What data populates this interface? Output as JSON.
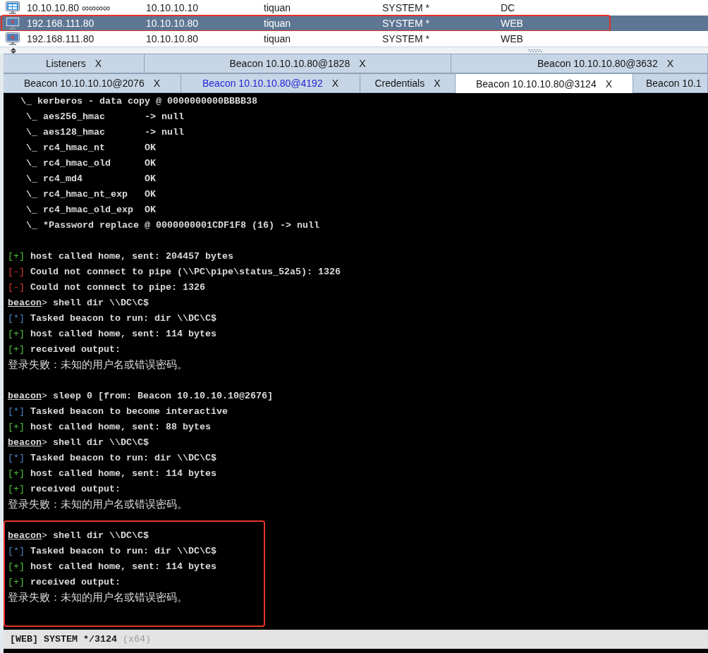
{
  "sessions": {
    "rows": [
      {
        "kind": "monitor",
        "cells": [
          "10.10.10.80 ∞∞∞∞",
          "10.10.10.10",
          "tiquan",
          "SYSTEM *",
          "DC"
        ],
        "selected": false,
        "highlighted": false
      },
      {
        "kind": "bolt",
        "cells": [
          "192.168.111.80",
          "10.10.10.80",
          "tiquan",
          "SYSTEM *",
          "WEB"
        ],
        "selected": true,
        "highlighted": true
      },
      {
        "kind": "bolt",
        "cells": [
          "192.168.111.80",
          "10.10.10.80",
          "tiquan",
          "SYSTEM *",
          "WEB"
        ],
        "selected": false,
        "highlighted": false
      }
    ]
  },
  "tabs": {
    "rows": [
      [
        {
          "label": "Listeners",
          "close": "X",
          "selected": false,
          "highlighted": false
        },
        {
          "label": "Beacon 10.10.10.80@1828",
          "close": "X",
          "selected": false,
          "highlighted": false
        },
        {
          "label": "Beacon 10.10.10.80@3632",
          "close": "X",
          "selected": false,
          "highlighted": false
        }
      ],
      [
        {
          "label": "Beacon 10.10.10.10@2076",
          "close": "X",
          "selected": false,
          "highlighted": false
        },
        {
          "label": "Beacon 10.10.10.80@4192",
          "close": "X",
          "selected": false,
          "highlighted": true
        },
        {
          "label": "Credentials",
          "close": "X",
          "selected": false,
          "highlighted": false
        },
        {
          "label": "Beacon 10.10.10.80@3124",
          "close": "X",
          "selected": true,
          "highlighted": false
        },
        {
          "label": "Beacon 10.1",
          "selected": false,
          "highlighted": false
        }
      ]
    ]
  },
  "console": {
    "blocks": [
      {
        "highlighted": false,
        "lines": [
          {
            "kind": "tree",
            "text": "\\_ kerberos - data copy @ 0000000000BBBB38",
            "children": [
              {
                "kind": "tree",
                "text": "\\_ aes256_hmac       -> null"
              },
              {
                "kind": "tree",
                "text": "\\_ aes128_hmac       -> null"
              },
              {
                "kind": "tree",
                "text": "\\_ rc4_hmac_nt       OK"
              },
              {
                "kind": "tree",
                "text": "\\_ rc4_hmac_old      OK"
              },
              {
                "kind": "tree",
                "text": "\\_ rc4_md4           OK"
              },
              {
                "kind": "tree",
                "text": "\\_ rc4_hmac_nt_exp   OK"
              },
              {
                "kind": "tree",
                "text": "\\_ rc4_hmac_old_exp  OK"
              },
              {
                "kind": "tree",
                "text": "\\_ *Password replace @ 0000000001CDF1F8 (16) -> null"
              }
            ]
          }
        ]
      },
      {
        "highlighted": false,
        "lines": [
          {
            "kind": "success",
            "marker": "[+]",
            "text": "host called home, sent: 204457 bytes"
          },
          {
            "kind": "error",
            "marker": "[-]",
            "text": "Could not connect to pipe (\\\\PC\\pipe\\status_52a5): 1326"
          },
          {
            "kind": "error",
            "marker": "[-]",
            "text": "Could not connect to pipe: 1326"
          },
          {
            "kind": "prompt",
            "prompt": "beacon",
            "sep": ">",
            "text": "shell dir \\\\DC\\C$"
          },
          {
            "kind": "info",
            "marker": "[*]",
            "text": "Tasked beacon to run: dir \\\\DC\\C$"
          },
          {
            "kind": "success",
            "marker": "[+]",
            "text": "host called home, sent: 114 bytes"
          },
          {
            "kind": "success",
            "marker": "[+]",
            "text": "received output:"
          },
          {
            "kind": "output",
            "text": "登录失败：未知的用户名或错误密码。"
          }
        ]
      },
      {
        "highlighted": false,
        "lines": [
          {
            "kind": "prompt",
            "prompt": "beacon",
            "sep": ">",
            "text": "sleep 0 [from: Beacon 10.10.10.10@2676]"
          },
          {
            "kind": "info",
            "marker": "[*]",
            "text": "Tasked beacon to become interactive"
          },
          {
            "kind": "success",
            "marker": "[+]",
            "text": "host called home, sent: 88 bytes"
          },
          {
            "kind": "prompt",
            "prompt": "beacon",
            "sep": ">",
            "text": "shell dir \\\\DC\\C$"
          },
          {
            "kind": "info",
            "marker": "[*]",
            "text": "Tasked beacon to run: dir \\\\DC\\C$"
          },
          {
            "kind": "success",
            "marker": "[+]",
            "text": "host called home, sent: 114 bytes"
          },
          {
            "kind": "success",
            "marker": "[+]",
            "text": "received output:"
          },
          {
            "kind": "output",
            "text": "登录失败：未知的用户名或错误密码。"
          }
        ]
      },
      {
        "highlighted": true,
        "lines": [
          {
            "kind": "prompt",
            "prompt": "beacon",
            "sep": ">",
            "text": "shell dir \\\\DC\\C$"
          },
          {
            "kind": "info",
            "marker": "[*]",
            "text": "Tasked beacon to run: dir \\\\DC\\C$"
          },
          {
            "kind": "success",
            "marker": "[+]",
            "text": "host called home, sent: 114 bytes"
          },
          {
            "kind": "success",
            "marker": "[+]",
            "text": "received output:"
          },
          {
            "kind": "output",
            "text": "登录失败：未知的用户名或错误密码。"
          }
        ]
      }
    ]
  },
  "status_bar": {
    "text": "[WEB] SYSTEM */3124",
    "arch": "(x64)"
  }
}
